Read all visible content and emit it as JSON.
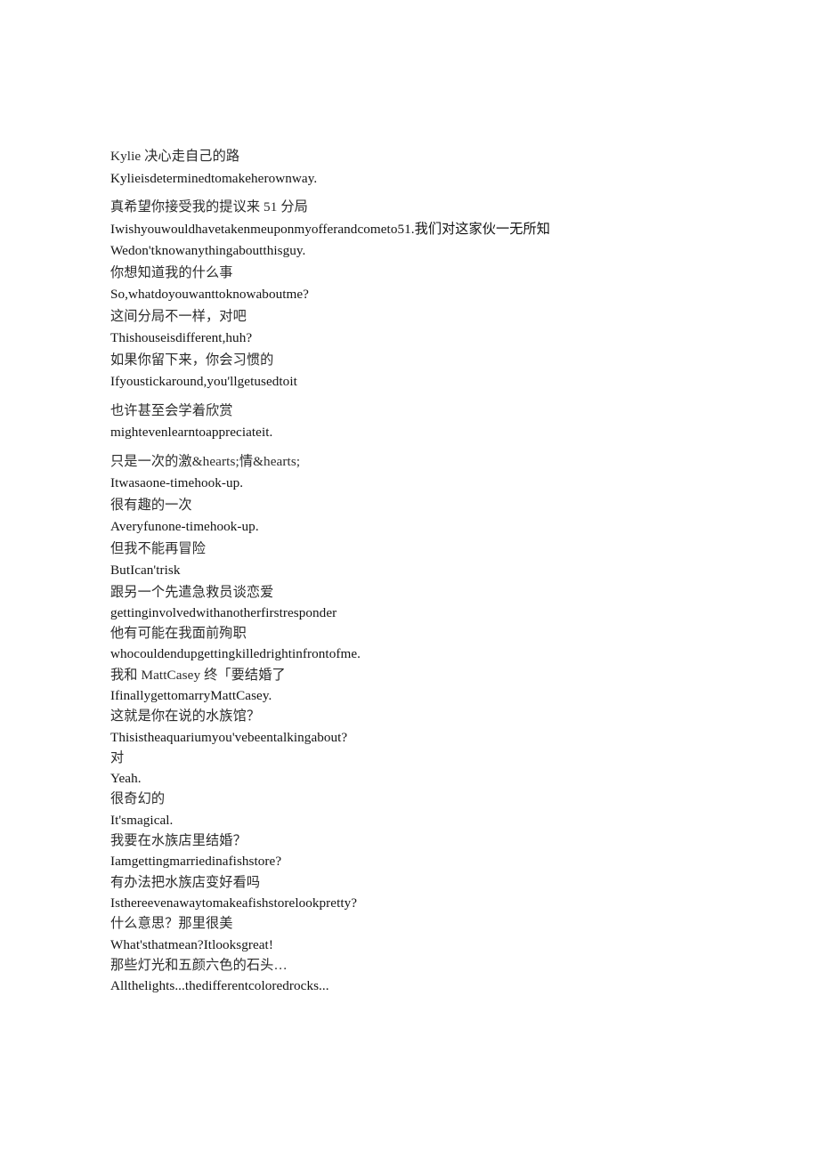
{
  "document": {
    "page_background": "#ffffff",
    "text_color": "#1a1a1a",
    "blocks": [
      {
        "zh": "Kylie 决心走自己的路",
        "en": "Kylieisdeterminedtomakeherownway."
      },
      {
        "zh": "真希望你接受我的提议来 51 分局",
        "en": "Iwishyouwouldhavetakenmeuponmyofferandcometo51.我们对这家伙一无所知"
      },
      {
        "zh": "",
        "en": "Wedon'tknowanythingaboutthisguy."
      },
      {
        "zh": "你想知道我的什么事",
        "en": "So,whatdoyouwanttoknowaboutme?"
      },
      {
        "zh": "这间分局不一样，对吧",
        "en": "Thishouseisdifferent,huh?"
      },
      {
        "zh": "如果你留下来，你会习惯的",
        "en": "Ifyoustickaround,you'llgetusedtoit"
      },
      {
        "zh": "也许甚至会学着欣赏",
        "en": "mightevenlearntoappreciateit."
      },
      {
        "zh": "只是一次的激&hearts;情&hearts;",
        "en": "Itwasaone-timehook-up."
      },
      {
        "zh": "很有趣的一次",
        "en": "Averyfunone-timehook-up."
      },
      {
        "zh": "但我不能再冒险",
        "en": "ButIcan'trisk"
      },
      {
        "zh": "跟另一个先遣急救员谈恋爱",
        "en": "gettinginvolvedwithanotherfirstresponder"
      },
      {
        "zh": "他有可能在我面前殉职",
        "en": "whocouldendupgettingkilledrightinfrontofme."
      },
      {
        "zh": "我和 MattCasey 终「要结婚了",
        "en": "IfinallygettomarryMattCasey."
      },
      {
        "zh": "这就是你在说的水族馆？",
        "en": "Thisistheaquariumyou'vebeentalkingabout?"
      },
      {
        "zh": "对",
        "en": "Yeah."
      },
      {
        "zh": "很奇幻的",
        "en": "It'smagical."
      },
      {
        "zh": "我要在水族店里结婚？",
        "en": "Iamgettingmarriedinafishstore?"
      },
      {
        "zh": "有办法把水族店变好看吗",
        "en": "Isthereevenawaytomakeafishstorelookpretty?"
      },
      {
        "zh": "什么意思？那里很美",
        "en": "What'sthatmean?Itlooksgreat!"
      },
      {
        "zh": "那些灯光和五颜六色的石头…",
        "en": "Allthelights...thedifferentcoloredrocks..."
      }
    ]
  }
}
